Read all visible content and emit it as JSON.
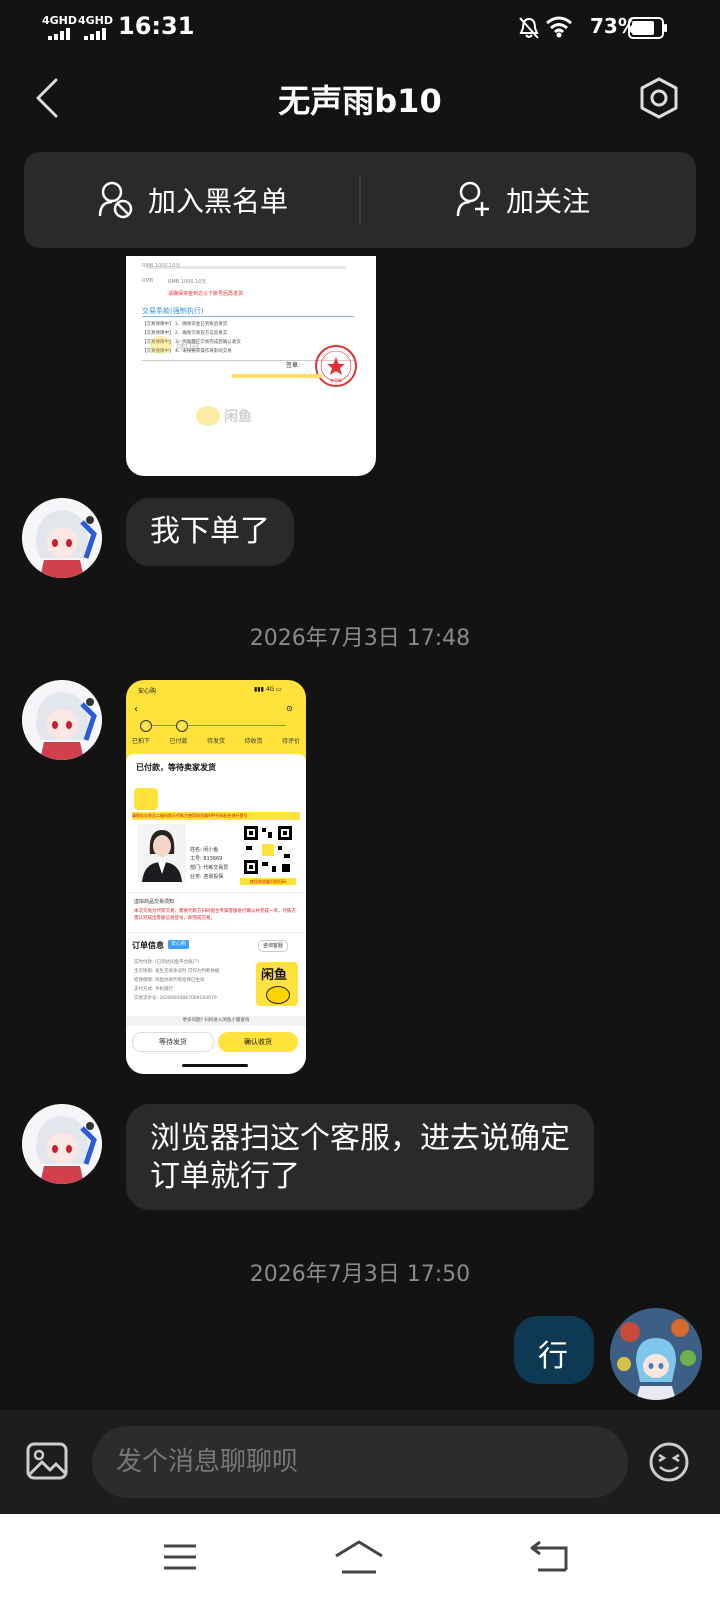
{
  "status": {
    "network1": "4GHD",
    "network2": "4GHD",
    "time": "16:31",
    "battery": "73%"
  },
  "header": {
    "title": "无声雨b10"
  },
  "actions": {
    "blacklist": "加入黑名单",
    "follow": "加关注"
  },
  "screenshot1": {
    "rows": [
      "RMB 1000.10元",
      "请确保资金到达以下账号后再发货"
    ],
    "section": "交易条款(强制执行)",
    "terms": [
      "【交易保障中】 1、确保资金已到账后发货",
      "【交易保障中】 2、确保交易双方信息真实",
      "【交易保障中】 3、买家需在交易完成后确认收货",
      "【交易保障中】 4、未按要求操作将影响交易"
    ],
    "sign": "签章:",
    "stamp_text": "专用章",
    "watermark": "闲鱼"
  },
  "messages": {
    "m1": "我下单了",
    "ts1": "2026年7月3日 17:48",
    "m3": "浏览器扫这个客服，进去说确定订单就行了",
    "ts2": "2026年7月3日 17:50",
    "m4": "行"
  },
  "screenshot2": {
    "brand": "安心购",
    "steps": [
      "已拍下",
      "已付款",
      "待发货",
      "待收货",
      "待评价"
    ],
    "paid_title": "已付款，等待卖家发货",
    "notice": "请保存交易员二维码提示代练方使用浏览器APP扫码配合进行登号",
    "agent": [
      "姓名: 闲小鱼",
      "工号: 813669",
      "部门: 代练交易员",
      "业务: 咨询投保"
    ],
    "qr_caption": "使用浏览器识别扫码",
    "risk_title": "虚拟商品交易须知",
    "risk_text": "本次交易为代练交易，需要代练方扫码配合专属客服进行确认并完成一单，代练方需认完成出客服信息登号，即完成交易。",
    "order_title": "订单信息",
    "order_badge": "安心购",
    "order_service": "咨询客服",
    "order_rows": [
      "实时付款: (已到达闲鱼平台账户)",
      "宝贝快照: 发生交易争议时,可作为判断依据",
      "担保保障: 闲鱼协助代练担保已生效",
      "支付方式: 手机银行",
      "交易流水号: 20260004887009164679"
    ],
    "logo_text": "闲鱼",
    "help": "更多问题? 扫码进入闲鱼小蜜查询",
    "btn_wait": "等待发货",
    "btn_confirm": "确认收货"
  },
  "input": {
    "placeholder": "发个消息聊聊呗"
  },
  "colors": {
    "background": "#131313",
    "bubble_in": "#2a2a2c",
    "bubble_out": "#0d3a52",
    "brand_yellow": "#ffe33c"
  }
}
